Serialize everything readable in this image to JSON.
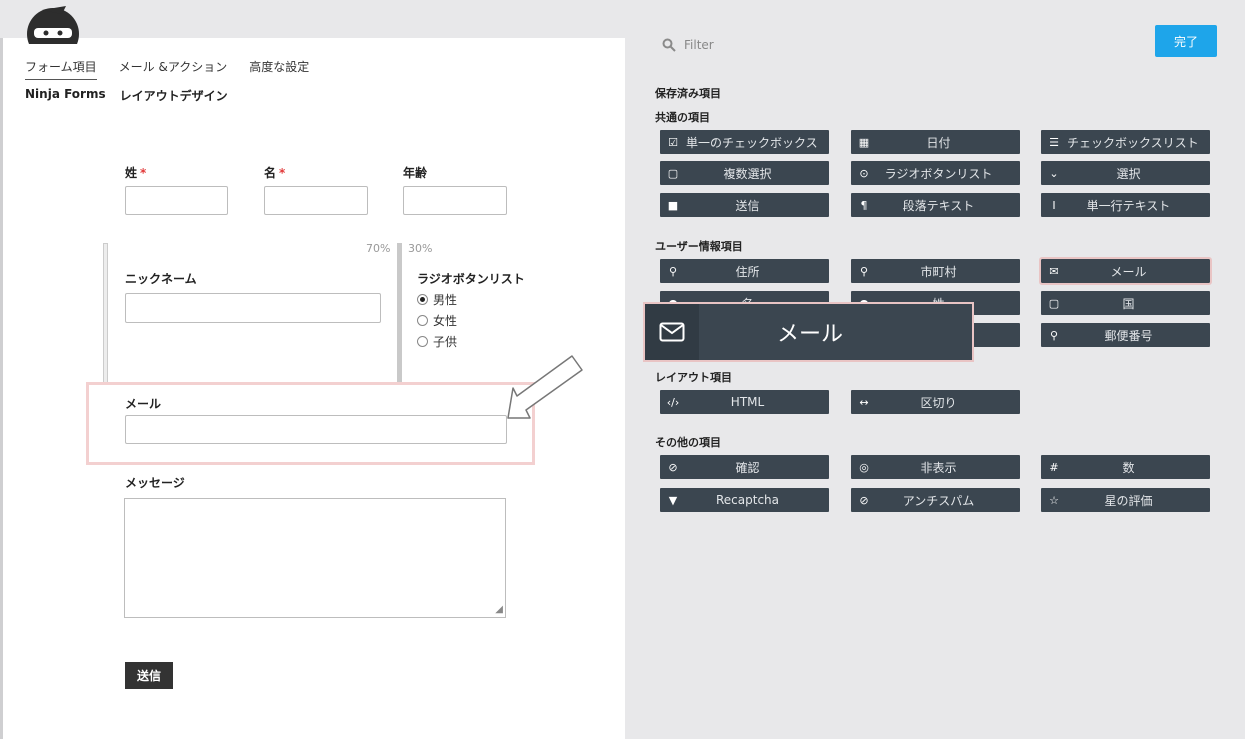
{
  "window": {
    "title": "Ninja Forms"
  },
  "tabs": [
    "フォーム項目",
    "メール &アクション",
    "高度な設定"
  ],
  "subtabs": [
    "Ninja Forms",
    "レイアウトデザイン"
  ],
  "form": {
    "last_name_label": "姓",
    "first_name_label": "名",
    "age_label": "年齢",
    "required_mark": "*",
    "col_left_pct": "70%",
    "col_right_pct": "30%",
    "nickname_label": "ニックネーム",
    "radio_label": "ラジオボタンリスト",
    "radio_options": [
      "男性",
      "女性",
      "子供"
    ],
    "radio_selected": "男性",
    "email_label": "メール",
    "message_label": "メッセージ",
    "submit_label": "送信"
  },
  "sidebar": {
    "filter_placeholder": "Filter",
    "done_label": "完了",
    "saved_heading": "保存済み項目",
    "common_heading": "共通の項目",
    "common_items": [
      {
        "label": "単一のチェックボックス",
        "icon": "checkbox-icon"
      },
      {
        "label": "日付",
        "icon": "calendar-icon"
      },
      {
        "label": "チェックボックスリスト",
        "icon": "list-icon"
      },
      {
        "label": "複数選択",
        "icon": "square-icon"
      },
      {
        "label": "ラジオボタンリスト",
        "icon": "radio-icon"
      },
      {
        "label": "選択",
        "icon": "chevron-down-icon"
      },
      {
        "label": "送信",
        "icon": "filled-square-icon"
      },
      {
        "label": "段落テキスト",
        "icon": "paragraph-icon"
      },
      {
        "label": "単一行テキスト",
        "icon": "text-cursor-icon"
      }
    ],
    "user_heading": "ユーザー情報項目",
    "user_items": [
      {
        "label": "住所",
        "icon": "map-marker-icon"
      },
      {
        "label": "市町村",
        "icon": "map-marker-icon"
      },
      {
        "label": "メール",
        "icon": "envelope-icon"
      },
      {
        "label": "名",
        "icon": "user-icon"
      },
      {
        "label": "姓",
        "icon": "user-icon"
      },
      {
        "label": "国",
        "icon": "square-icon"
      },
      {
        "label": "",
        "icon": ""
      },
      {
        "label": "",
        "icon": ""
      },
      {
        "label": "郵便番号",
        "icon": "map-marker-icon"
      }
    ],
    "layout_heading": "レイアウト項目",
    "layout_items": [
      {
        "label": "HTML",
        "icon": "code-icon"
      },
      {
        "label": "区切り",
        "icon": "divider-icon"
      }
    ],
    "other_heading": "その他の項目",
    "other_items": [
      {
        "label": "確認",
        "icon": "check-circle-icon"
      },
      {
        "label": "非表示",
        "icon": "eye-slash-icon"
      },
      {
        "label": "数",
        "icon": "hash-icon"
      },
      {
        "label": "Recaptcha",
        "icon": "filter-icon"
      },
      {
        "label": "アンチスパム",
        "icon": "ban-icon"
      },
      {
        "label": "星の評価",
        "icon": "star-icon"
      }
    ],
    "drag_label": "メール"
  }
}
